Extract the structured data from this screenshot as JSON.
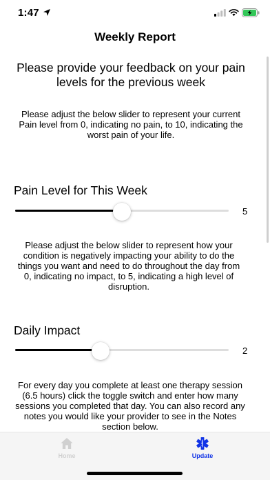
{
  "status_bar": {
    "time": "1:47",
    "location_icon": "location-arrow-icon",
    "signal_icon": "cellular-signal-icon",
    "wifi_icon": "wifi-icon",
    "battery_icon": "battery-charging-icon",
    "battery_color": "#34c759"
  },
  "header": {
    "title": "Weekly Report"
  },
  "intro": "Please provide your feedback on your pain levels for the previous week",
  "pain_section": {
    "instruction": "Please adjust the below slider to represent your current Pain level from 0, indicating no pain, to 10, indicating the worst pain of your life.",
    "label": "Pain Level for This Week",
    "value": 5,
    "min": 0,
    "max": 10,
    "value_text": "5"
  },
  "impact_section": {
    "instruction": "Please adjust the below slider to represent how your condition is negatively impacting your ability to do the things you want and need to do throughout the day from 0, indicating no impact, to 5, indicating a high level of disruption.",
    "label": "Daily Impact",
    "value": 2,
    "min": 0,
    "max": 5,
    "value_text": "2"
  },
  "therapy_instruction": "For every day you complete at least one therapy session (6.5 hours) click the toggle switch and enter how many sessions you completed that day. You can also record any notes you would like your provider to see in the Notes section below.",
  "tab_bar": {
    "tabs": [
      {
        "label": "Home",
        "icon": "home-icon",
        "active": false
      },
      {
        "label": "Update",
        "icon": "medical-star-icon",
        "active": true
      }
    ],
    "active_color": "#1033e6",
    "inactive_color": "#d0d0d0"
  }
}
